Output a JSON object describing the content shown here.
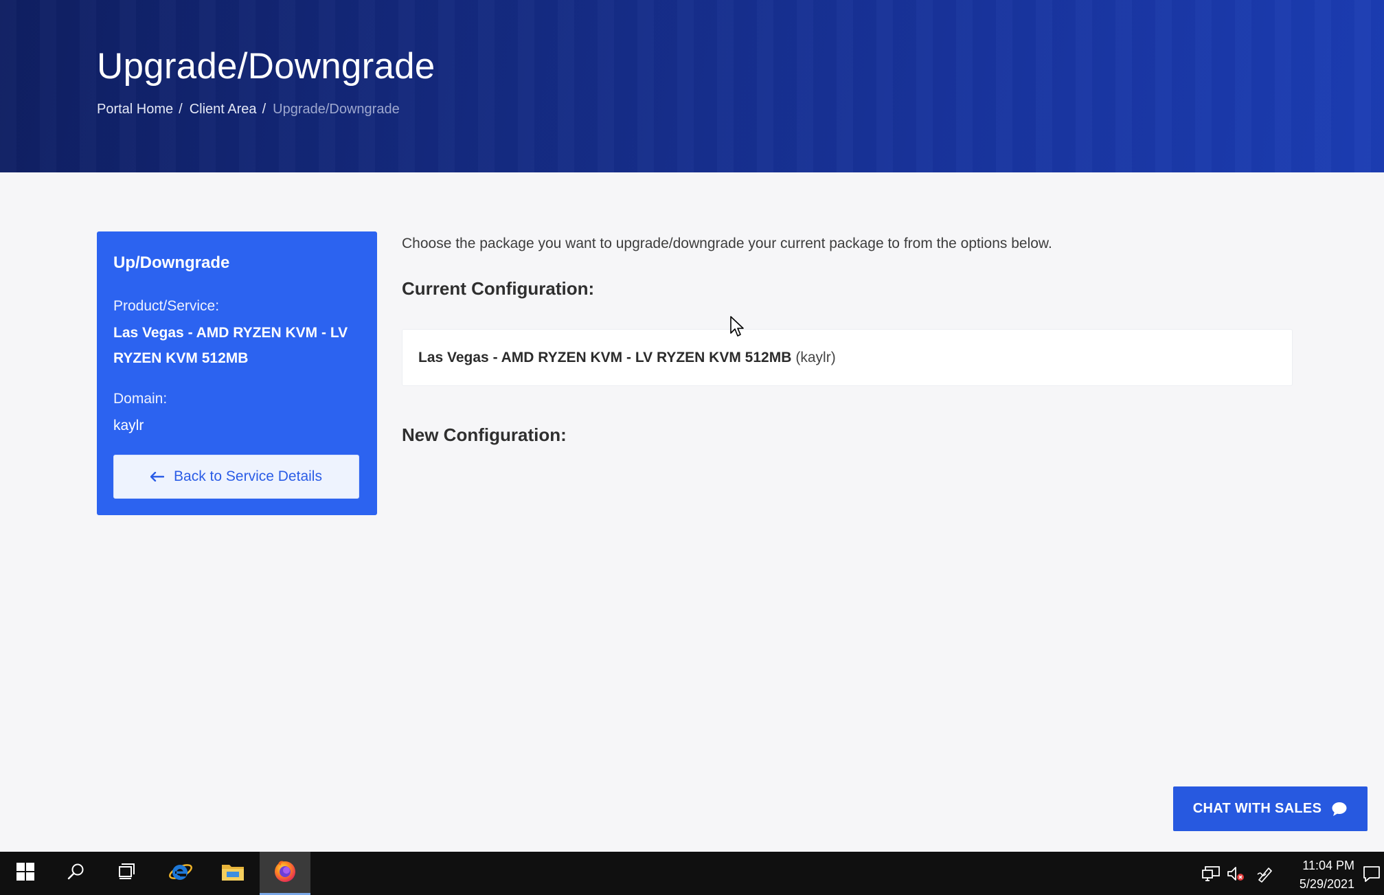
{
  "header": {
    "title": "Upgrade/Downgrade",
    "breadcrumb": {
      "home": "Portal Home",
      "client_area": "Client Area",
      "current": "Upgrade/Downgrade",
      "separator": "/"
    }
  },
  "sidebar": {
    "title": "Up/Downgrade",
    "product_label": "Product/Service:",
    "product_value": "Las Vegas - AMD RYZEN KVM - LV RYZEN KVM 512MB",
    "domain_label": "Domain:",
    "domain_value": "kaylr",
    "back_button": "Back to Service Details"
  },
  "main": {
    "intro": "Choose the package you want to upgrade/downgrade your current package to from the options below.",
    "current_heading": "Current Configuration:",
    "current_product": "Las Vegas - AMD RYZEN KVM - LV RYZEN KVM 512MB",
    "current_domain": "(kaylr)",
    "new_heading": "New Configuration:"
  },
  "chat": {
    "label": "CHAT WITH SALES"
  },
  "taskbar": {
    "time": "11:04 PM",
    "date": "5/29/2021",
    "apps": [
      "start-icon",
      "search-icon",
      "task-view-icon",
      "internet-explorer-icon",
      "file-explorer-icon",
      "firefox-icon"
    ]
  },
  "colors": {
    "header_bg": "#142a80",
    "sidebar_bg": "#2c63f0",
    "accent": "#2759e0",
    "page_bg": "#f6f6f8"
  }
}
